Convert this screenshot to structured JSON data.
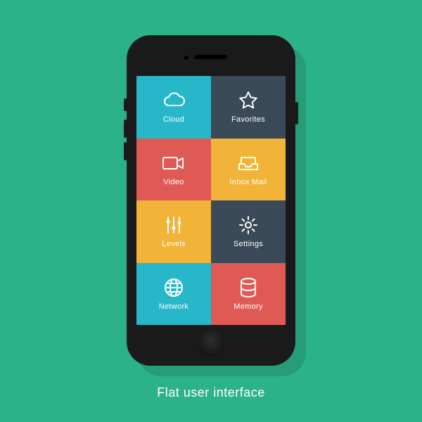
{
  "caption": "Flat user interface",
  "tiles": [
    {
      "id": "cloud",
      "label": "Cloud",
      "icon": "cloud-icon",
      "bg": "#28b6c9"
    },
    {
      "id": "favorites",
      "label": "Favorites",
      "icon": "star-icon",
      "bg": "#3a4a58"
    },
    {
      "id": "video",
      "label": "Video",
      "icon": "video-icon",
      "bg": "#e05a55"
    },
    {
      "id": "inbox",
      "label": "Inbox Mail",
      "icon": "inbox-icon",
      "bg": "#f1b338"
    },
    {
      "id": "levels",
      "label": "Levels",
      "icon": "levels-icon",
      "bg": "#f1b338"
    },
    {
      "id": "settings",
      "label": "Settings",
      "icon": "gear-icon",
      "bg": "#3a4a58"
    },
    {
      "id": "network",
      "label": "Network",
      "icon": "globe-icon",
      "bg": "#28b6c9"
    },
    {
      "id": "memory",
      "label": "Memory",
      "icon": "database-icon",
      "bg": "#e05a55"
    }
  ]
}
